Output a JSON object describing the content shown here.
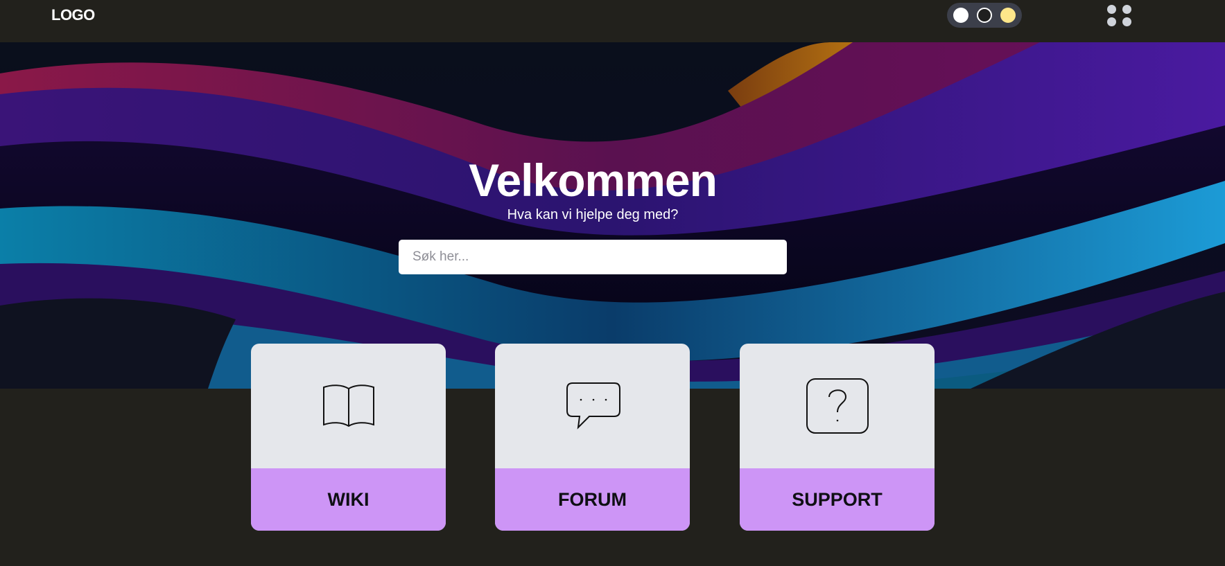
{
  "header": {
    "logo": "LOGO",
    "theme_options": [
      "light-theme",
      "dark-theme",
      "warm-theme"
    ],
    "apps_icon": "grid-dots-icon"
  },
  "hero": {
    "title": "Velkommen",
    "subtitle": "Hva kan vi hjelpe deg med?",
    "search_placeholder": "Søk her...",
    "search_value": ""
  },
  "cards": [
    {
      "label": "WIKI",
      "icon": "open-book-icon"
    },
    {
      "label": "FORUM",
      "icon": "speech-bubble-icon"
    },
    {
      "label": "SUPPORT",
      "icon": "question-mark-icon"
    }
  ],
  "colors": {
    "background": "#22211c",
    "card_top": "#e5e7eb",
    "card_label": "#cd95f6",
    "theme_switch": "#3c3f4a",
    "warm_dot": "#fde68a"
  }
}
